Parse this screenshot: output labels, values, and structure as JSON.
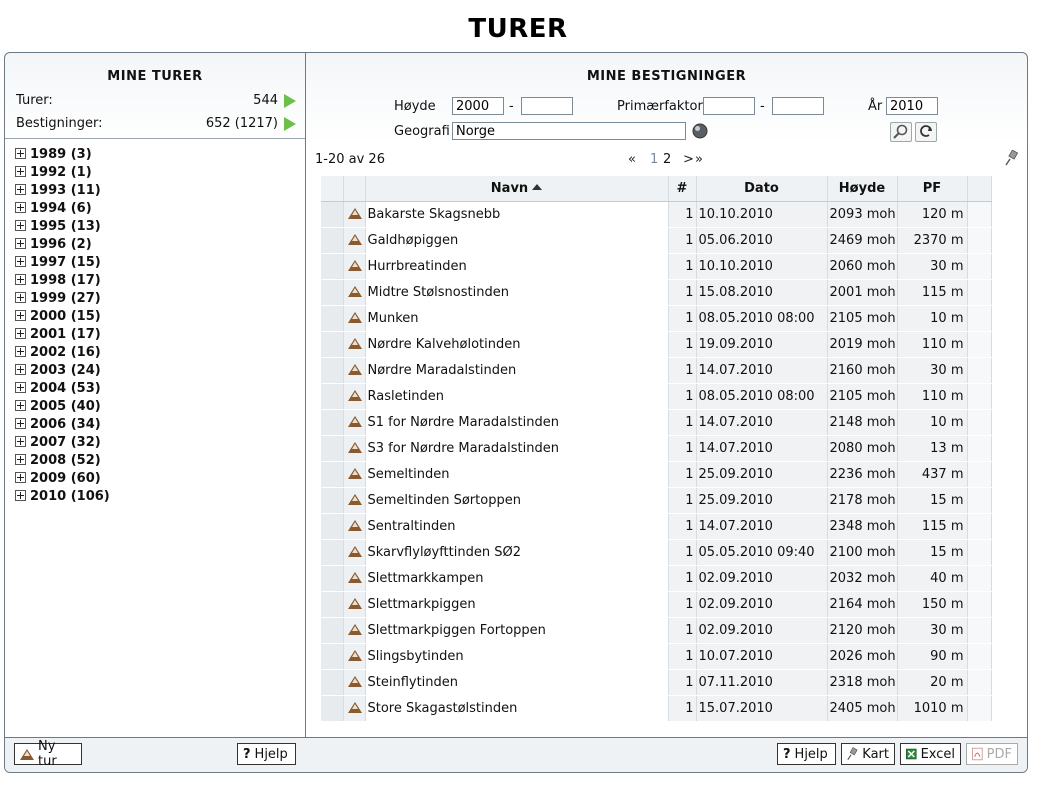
{
  "title": "TURER",
  "left": {
    "title": "MINE TURER",
    "stats": [
      {
        "label": "Turer:",
        "value": "544"
      },
      {
        "label": "Bestigninger:",
        "value": "652 (1217)"
      }
    ],
    "years": [
      "1989 (3)",
      "1992 (1)",
      "1993 (11)",
      "1994 (6)",
      "1995 (13)",
      "1996 (2)",
      "1997 (15)",
      "1998 (17)",
      "1999 (27)",
      "2000 (15)",
      "2001 (17)",
      "2002 (16)",
      "2003 (24)",
      "2004 (53)",
      "2005 (40)",
      "2006 (34)",
      "2007 (32)",
      "2008 (52)",
      "2009 (60)",
      "2010 (106)"
    ],
    "buttons": {
      "new": "Ny tur",
      "help": "Hjelp"
    }
  },
  "right": {
    "title": "MINE BESTIGNINGER",
    "filters": {
      "height_label": "Høyde",
      "height_from": "2000",
      "height_to": "",
      "dash": "-",
      "prominence_label": "Primærfaktor",
      "prominence_from": "",
      "prominence_to": "",
      "year_label": "År",
      "year": "2010",
      "geo_label": "Geografi",
      "geo": "Norge"
    },
    "pager": {
      "range": "1-20 av 26",
      "first": "«",
      "page1": "1",
      "page2": "2",
      "next": ">",
      "last": "»"
    },
    "columns": {
      "name": "Navn",
      "count": "#",
      "date": "Dato",
      "height": "Høyde",
      "pf": "PF"
    },
    "rows": [
      {
        "name": "Bakarste Skagsnebb",
        "count": "1",
        "date": "10.10.2010",
        "height": "2093 moh",
        "pf": "120 m"
      },
      {
        "name": "Galdhøpiggen",
        "count": "1",
        "date": "05.06.2010",
        "height": "2469 moh",
        "pf": "2370 m"
      },
      {
        "name": "Hurrbreatinden",
        "count": "1",
        "date": "10.10.2010",
        "height": "2060 moh",
        "pf": "30 m"
      },
      {
        "name": "Midtre Stølsnostinden",
        "count": "1",
        "date": "15.08.2010",
        "height": "2001 moh",
        "pf": "115 m"
      },
      {
        "name": "Munken",
        "count": "1",
        "date": "08.05.2010 08:00",
        "height": "2105 moh",
        "pf": "10 m"
      },
      {
        "name": "Nørdre Kalvehølotinden",
        "count": "1",
        "date": "19.09.2010",
        "height": "2019 moh",
        "pf": "110 m"
      },
      {
        "name": "Nørdre Maradalstinden",
        "count": "1",
        "date": "14.07.2010",
        "height": "2160 moh",
        "pf": "30 m"
      },
      {
        "name": "Rasletinden",
        "count": "1",
        "date": "08.05.2010 08:00",
        "height": "2105 moh",
        "pf": "110 m"
      },
      {
        "name": "S1 for Nørdre Maradalstinden",
        "count": "1",
        "date": "14.07.2010",
        "height": "2148 moh",
        "pf": "10 m"
      },
      {
        "name": "S3 for Nørdre Maradalstinden",
        "count": "1",
        "date": "14.07.2010",
        "height": "2080 moh",
        "pf": "13 m"
      },
      {
        "name": "Semeltinden",
        "count": "1",
        "date": "25.09.2010",
        "height": "2236 moh",
        "pf": "437 m"
      },
      {
        "name": "Semeltinden Sørtoppen",
        "count": "1",
        "date": "25.09.2010",
        "height": "2178 moh",
        "pf": "15 m"
      },
      {
        "name": "Sentraltinden",
        "count": "1",
        "date": "14.07.2010",
        "height": "2348 moh",
        "pf": "115 m"
      },
      {
        "name": "Skarvflyløyfttinden SØ2",
        "count": "1",
        "date": "05.05.2010 09:40",
        "height": "2100 moh",
        "pf": "15 m"
      },
      {
        "name": "Slettmarkkampen",
        "count": "1",
        "date": "02.09.2010",
        "height": "2032 moh",
        "pf": "40 m"
      },
      {
        "name": "Slettmarkpiggen",
        "count": "1",
        "date": "02.09.2010",
        "height": "2164 moh",
        "pf": "150 m"
      },
      {
        "name": "Slettmarkpiggen Fortoppen",
        "count": "1",
        "date": "02.09.2010",
        "height": "2120 moh",
        "pf": "30 m"
      },
      {
        "name": "Slingsbytinden",
        "count": "1",
        "date": "10.07.2010",
        "height": "2026 moh",
        "pf": "90 m"
      },
      {
        "name": "Steinflytinden",
        "count": "1",
        "date": "07.11.2010",
        "height": "2318 moh",
        "pf": "20 m"
      },
      {
        "name": "Store Skagastølstinden",
        "count": "1",
        "date": "15.07.2010",
        "height": "2405 moh",
        "pf": "1010 m"
      }
    ],
    "buttons": {
      "help": "Hjelp",
      "map": "Kart",
      "excel": "Excel",
      "pdf": "PDF"
    }
  },
  "colors": {
    "accent_green": "#6cc04a",
    "border": "#6c7a86",
    "mountain": "#8a5a2e"
  },
  "icons": [
    "expand-icon",
    "play-icon",
    "mountain-icon",
    "globe-icon",
    "search-icon",
    "refresh-icon",
    "pin-icon",
    "help-icon",
    "map-pin-icon",
    "excel-icon",
    "pdf-icon",
    "sort-asc-icon"
  ]
}
